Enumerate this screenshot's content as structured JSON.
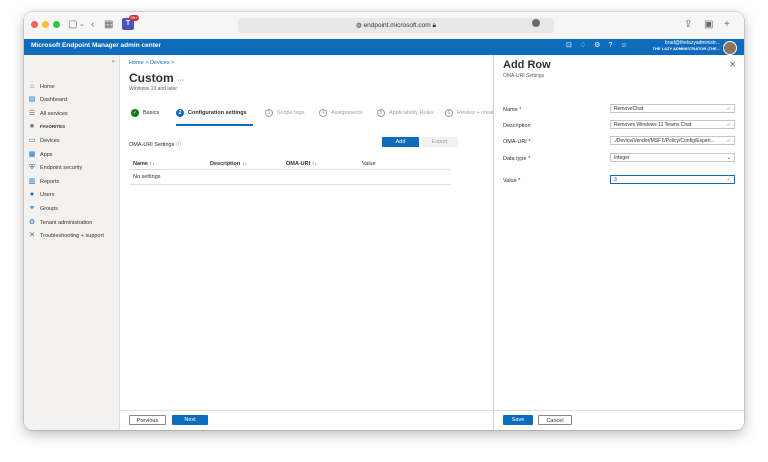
{
  "browser": {
    "url": "endpoint.microsoft.com",
    "lock_icon": "lock-icon",
    "teams_badge": "99+"
  },
  "app": {
    "title": "Microsoft Endpoint Manager admin center",
    "user_email": "brad@thelazyadministr...",
    "user_org": "THE LAZY ADMINISTRATOR (THE..."
  },
  "sidebar": {
    "collapse": "«",
    "items": [
      {
        "label": "Home",
        "icon": "home-icon"
      },
      {
        "label": "Dashboard",
        "icon": "dashboard-icon"
      },
      {
        "label": "All services",
        "icon": "list-icon"
      },
      {
        "label": "FAVORITES",
        "icon": "star-icon"
      },
      {
        "label": "Devices",
        "icon": "devices-icon"
      },
      {
        "label": "Apps",
        "icon": "apps-icon"
      },
      {
        "label": "Endpoint security",
        "icon": "shield-icon"
      },
      {
        "label": "Reports",
        "icon": "reports-icon"
      },
      {
        "label": "Users",
        "icon": "user-icon"
      },
      {
        "label": "Groups",
        "icon": "groups-icon"
      },
      {
        "label": "Tenant administration",
        "icon": "tenant-icon"
      },
      {
        "label": "Troubleshooting + support",
        "icon": "wrench-icon"
      }
    ]
  },
  "main": {
    "breadcrumb": "Home  >  Devices  >",
    "title": "Custom",
    "more": "···",
    "subtitle": "Windows 10 and later",
    "steps": [
      {
        "label": "Basics",
        "marker": "✓"
      },
      {
        "label": "Configuration settings",
        "marker": "2"
      },
      {
        "label": "Scope tags",
        "marker": "3"
      },
      {
        "label": "Assignments",
        "marker": "4"
      },
      {
        "label": "Applicability Rules",
        "marker": "5"
      },
      {
        "label": "Review + create",
        "marker": "6"
      }
    ],
    "oma_label": "OMA-URI Settings",
    "info_icon": "ⓘ",
    "add_button": "Add",
    "export_button": "Export",
    "columns": [
      "Name",
      "Description",
      "OMA-URI",
      "Value"
    ],
    "sort_glyph": "↑↓",
    "empty_text": "No settings",
    "previous_button": "Previous",
    "next_button": "Next"
  },
  "pane": {
    "title": "Add Row",
    "subtitle": "OMA-URI Settings",
    "close": "✕",
    "fields": [
      {
        "label": "Name *",
        "value": "RemoveChat"
      },
      {
        "label": "Description",
        "value": "Removes Windows 11 Teams Chat"
      },
      {
        "label": "OMA-URI *",
        "value": "./Device/Vendor/MSFT/Policy/Config/Experi..."
      },
      {
        "label": "Data type *",
        "value": "Integer"
      },
      {
        "label": "Value *",
        "value": "3"
      }
    ],
    "save_button": "Save",
    "cancel_button": "Cancel"
  }
}
